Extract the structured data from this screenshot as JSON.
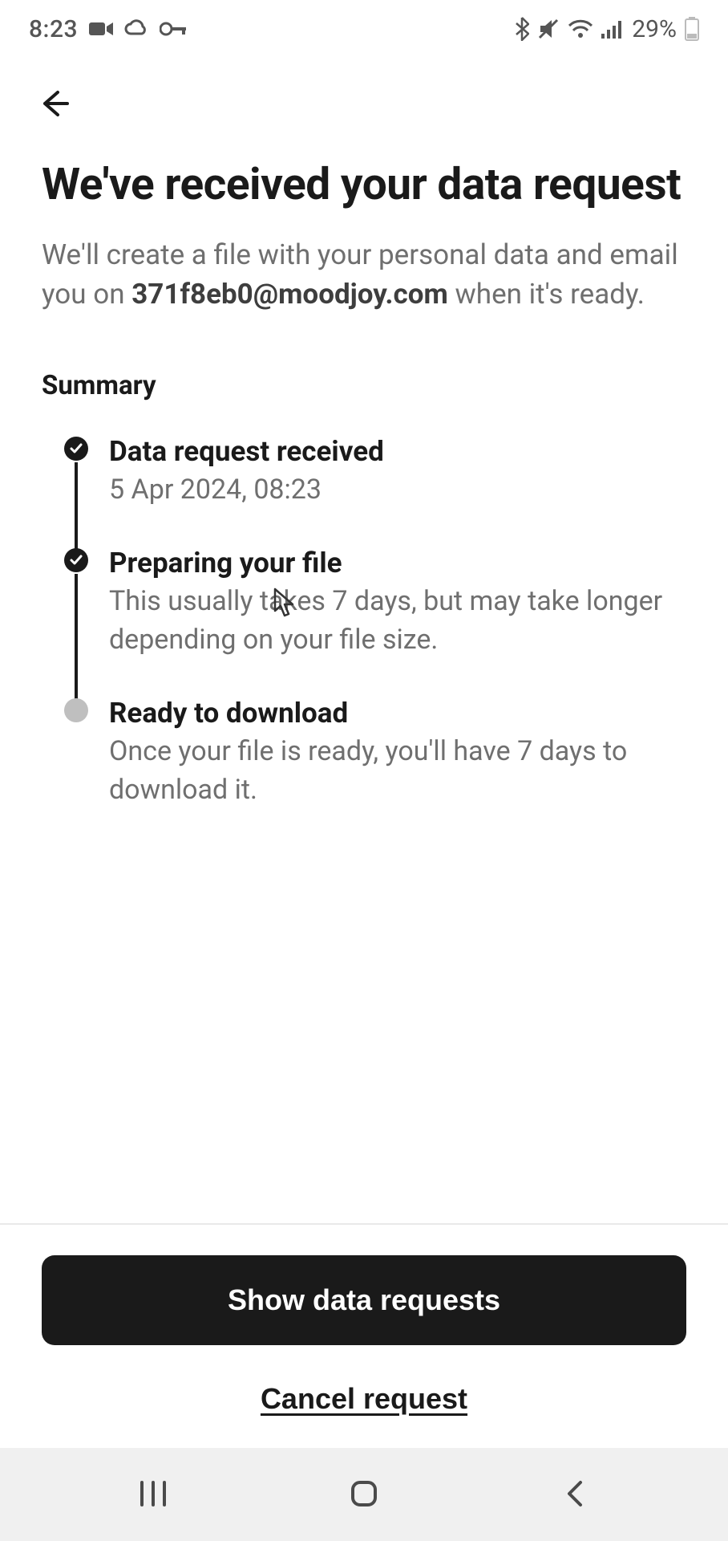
{
  "status": {
    "time": "8:23",
    "battery_pct": "29%"
  },
  "page": {
    "title": "We've received your data request",
    "sub_prefix": "We'll create a file with your personal data and email you on ",
    "email": "371f8eb0@moodjoy.com",
    "sub_suffix": " when it's ready.",
    "summary_heading": "Summary"
  },
  "timeline": [
    {
      "title": "Data request received",
      "desc": "5 Apr 2024, 08:23",
      "done": true
    },
    {
      "title": "Preparing your file",
      "desc": "This usually takes 7 days, but may take longer depending on your file size.",
      "done": true
    },
    {
      "title": "Ready to download",
      "desc": "Once your file is ready, you'll have 7 days to download it.",
      "done": false
    }
  ],
  "buttons": {
    "primary": "Show data requests",
    "cancel": "Cancel request"
  }
}
